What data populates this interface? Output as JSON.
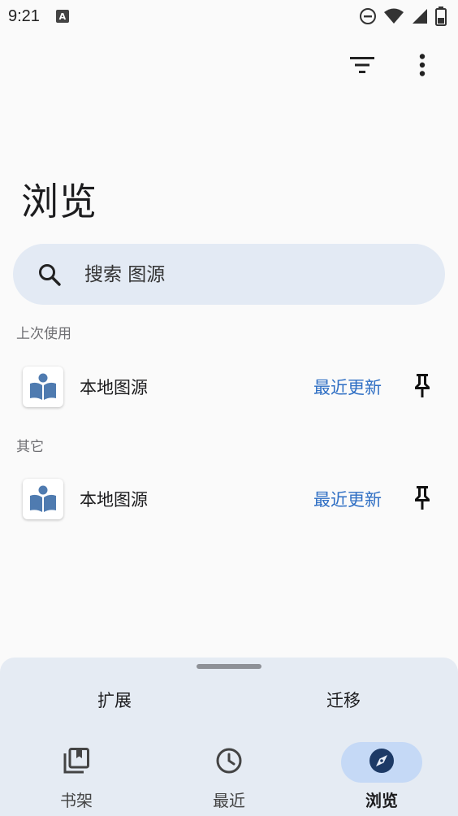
{
  "status_bar": {
    "time": "9:21",
    "notification_icon": "a-letter-icon",
    "icons": [
      "do-not-disturb-icon",
      "wifi-icon",
      "signal-icon",
      "battery-icon"
    ]
  },
  "toolbar": {
    "filter_icon": "filter-icon",
    "more_icon": "more-vert-icon"
  },
  "page": {
    "title": "浏览"
  },
  "search": {
    "placeholder": "搜索 图源",
    "value": ""
  },
  "sections": {
    "recent_label": "上次使用",
    "other_label": "其它"
  },
  "recent_sources": [
    {
      "name": "本地图源",
      "latest": "最近更新",
      "icon": "book-reader-icon",
      "pin_icon": "pin-icon"
    }
  ],
  "other_sources": [
    {
      "name": "本地图源",
      "latest": "最近更新",
      "icon": "book-reader-icon",
      "pin_icon": "pin-icon"
    }
  ],
  "bottom_sheet": {
    "tabs": [
      "扩展",
      "迁移"
    ]
  },
  "nav": {
    "items": [
      {
        "label": "书架",
        "icon": "library-icon",
        "active": false
      },
      {
        "label": "最近",
        "icon": "clock-icon",
        "active": false
      },
      {
        "label": "浏览",
        "icon": "compass-icon",
        "active": true
      }
    ]
  },
  "colors": {
    "accent": "#2f6fc4",
    "active_nav_bg": "#c5d9f6",
    "search_bg": "#e3eaf4",
    "sheet_bg": "#e5ebf3"
  }
}
